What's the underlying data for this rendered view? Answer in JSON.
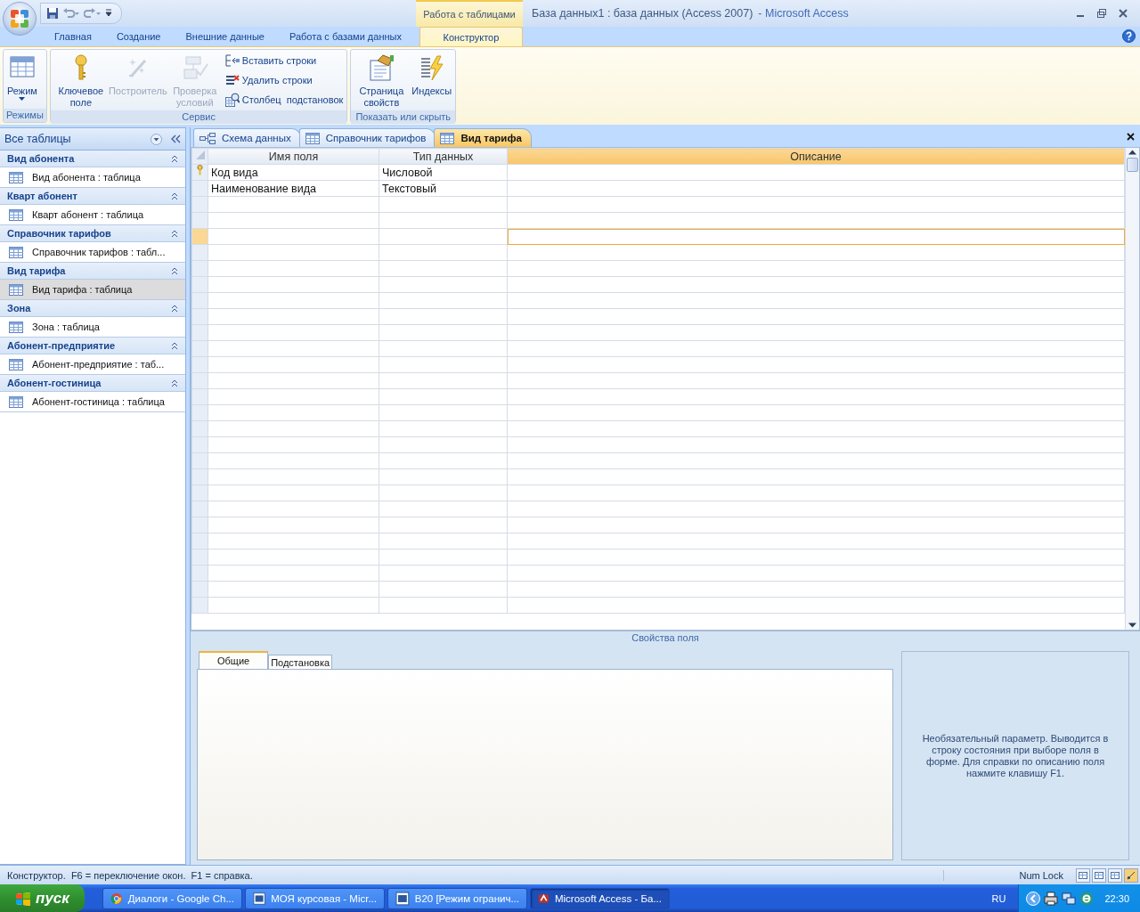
{
  "window": {
    "context_tab_group": "Работа с таблицами",
    "title_document": "База данных1 : база данных (Access 2007)",
    "title_app": "- Microsoft Access"
  },
  "ribbon_tabs": [
    {
      "label": "Главная",
      "selected": false
    },
    {
      "label": "Создание",
      "selected": false
    },
    {
      "label": "Внешние данные",
      "selected": false
    },
    {
      "label": "Работа с базами данных",
      "selected": false
    },
    {
      "label": "Конструктор",
      "selected": true
    }
  ],
  "ribbon_groups": [
    {
      "label": "Режимы",
      "buttons": [
        {
          "kind": "large",
          "label": "Режим",
          "dropdown": true,
          "disabled": false
        }
      ]
    },
    {
      "label": "Сервис",
      "buttons": [
        {
          "kind": "large",
          "label": "Ключевое поле",
          "disabled": false
        },
        {
          "kind": "large",
          "label": "Построитель",
          "disabled": true
        },
        {
          "kind": "large",
          "label": "Проверка условий",
          "disabled": true
        },
        {
          "kind": "small",
          "label": "Вставить строки",
          "disabled": false
        },
        {
          "kind": "small",
          "label": "Удалить строки",
          "disabled": false
        },
        {
          "kind": "small",
          "label": "Столбец  подстановок",
          "disabled": false
        }
      ]
    },
    {
      "label": "Показать или скрыть",
      "buttons": [
        {
          "kind": "large",
          "label": "Страница свойств",
          "disabled": false
        },
        {
          "kind": "large",
          "label": "Индексы",
          "disabled": false
        }
      ]
    }
  ],
  "navigation_pane": {
    "title": "Все таблицы",
    "groups": [
      {
        "title": "Вид абонента",
        "expanded": true,
        "items": [
          {
            "label": "Вид абонента : таблица",
            "selected": false
          }
        ]
      },
      {
        "title": "Кварт абонент",
        "expanded": true,
        "items": [
          {
            "label": "Кварт абонент : таблица",
            "selected": false
          }
        ]
      },
      {
        "title": "Справочник тарифов",
        "expanded": true,
        "items": [
          {
            "label": "Справочник тарифов : табл...",
            "selected": false
          }
        ]
      },
      {
        "title": "Вид тарифа",
        "expanded": true,
        "items": [
          {
            "label": "Вид тарифа : таблица",
            "selected": true
          }
        ]
      },
      {
        "title": "Зона",
        "expanded": true,
        "items": [
          {
            "label": "Зона : таблица",
            "selected": false
          }
        ]
      },
      {
        "title": "Абонент-предприятие",
        "expanded": true,
        "items": [
          {
            "label": "Абонент-предприятие : таб...",
            "selected": false
          }
        ]
      },
      {
        "title": "Абонент-гостиница",
        "expanded": true,
        "items": [
          {
            "label": "Абонент-гостиница : таблица",
            "selected": false
          }
        ]
      }
    ]
  },
  "document_tabs": [
    {
      "kind": "diagram",
      "label": "Схема данных",
      "selected": false
    },
    {
      "kind": "table",
      "label": "Справочник тарифов",
      "selected": false
    },
    {
      "kind": "table",
      "label": "Вид тарифа",
      "selected": true
    }
  ],
  "design_grid": {
    "columns": [
      {
        "label": "Имя поля",
        "selected": false
      },
      {
        "label": "Тип данных",
        "selected": false
      },
      {
        "label": "Описание",
        "selected": true
      }
    ],
    "rows": [
      {
        "key": true,
        "selected": false,
        "field_name": "Код вида",
        "data_type": "Числовой"
      },
      {
        "key": false,
        "selected": false,
        "field_name": "Наименование вида",
        "data_type": "Текстовый"
      },
      {
        "key": false,
        "selected": false
      },
      {
        "key": false,
        "selected": false
      },
      {
        "key": false,
        "selected": true
      }
    ]
  },
  "field_properties": {
    "title": "Свойства поля",
    "tabs": [
      {
        "label": "Общие",
        "selected": true
      },
      {
        "label": "Подстановка",
        "selected": false
      }
    ],
    "hint": "Необязательный параметр.  Выводится в строку состояния при выборе поля в форме.  Для справки по описанию поля нажмите клавишу F1."
  },
  "status_bar": {
    "text": "Конструктор.  F6 = переключение окон.  F1 = справка.",
    "num_lock": "Num Lock"
  },
  "taskbar": {
    "start": "пуск",
    "items": [
      {
        "label": "Диалоги - Google Ch...",
        "selected": false
      },
      {
        "label": "МОЯ курсовая - Micr...",
        "selected": false
      },
      {
        "label": "B20 [Режим огранич...",
        "selected": false
      },
      {
        "label": "Microsoft Access - Ба...",
        "selected": true
      }
    ],
    "language": "RU",
    "time": "22:30"
  }
}
